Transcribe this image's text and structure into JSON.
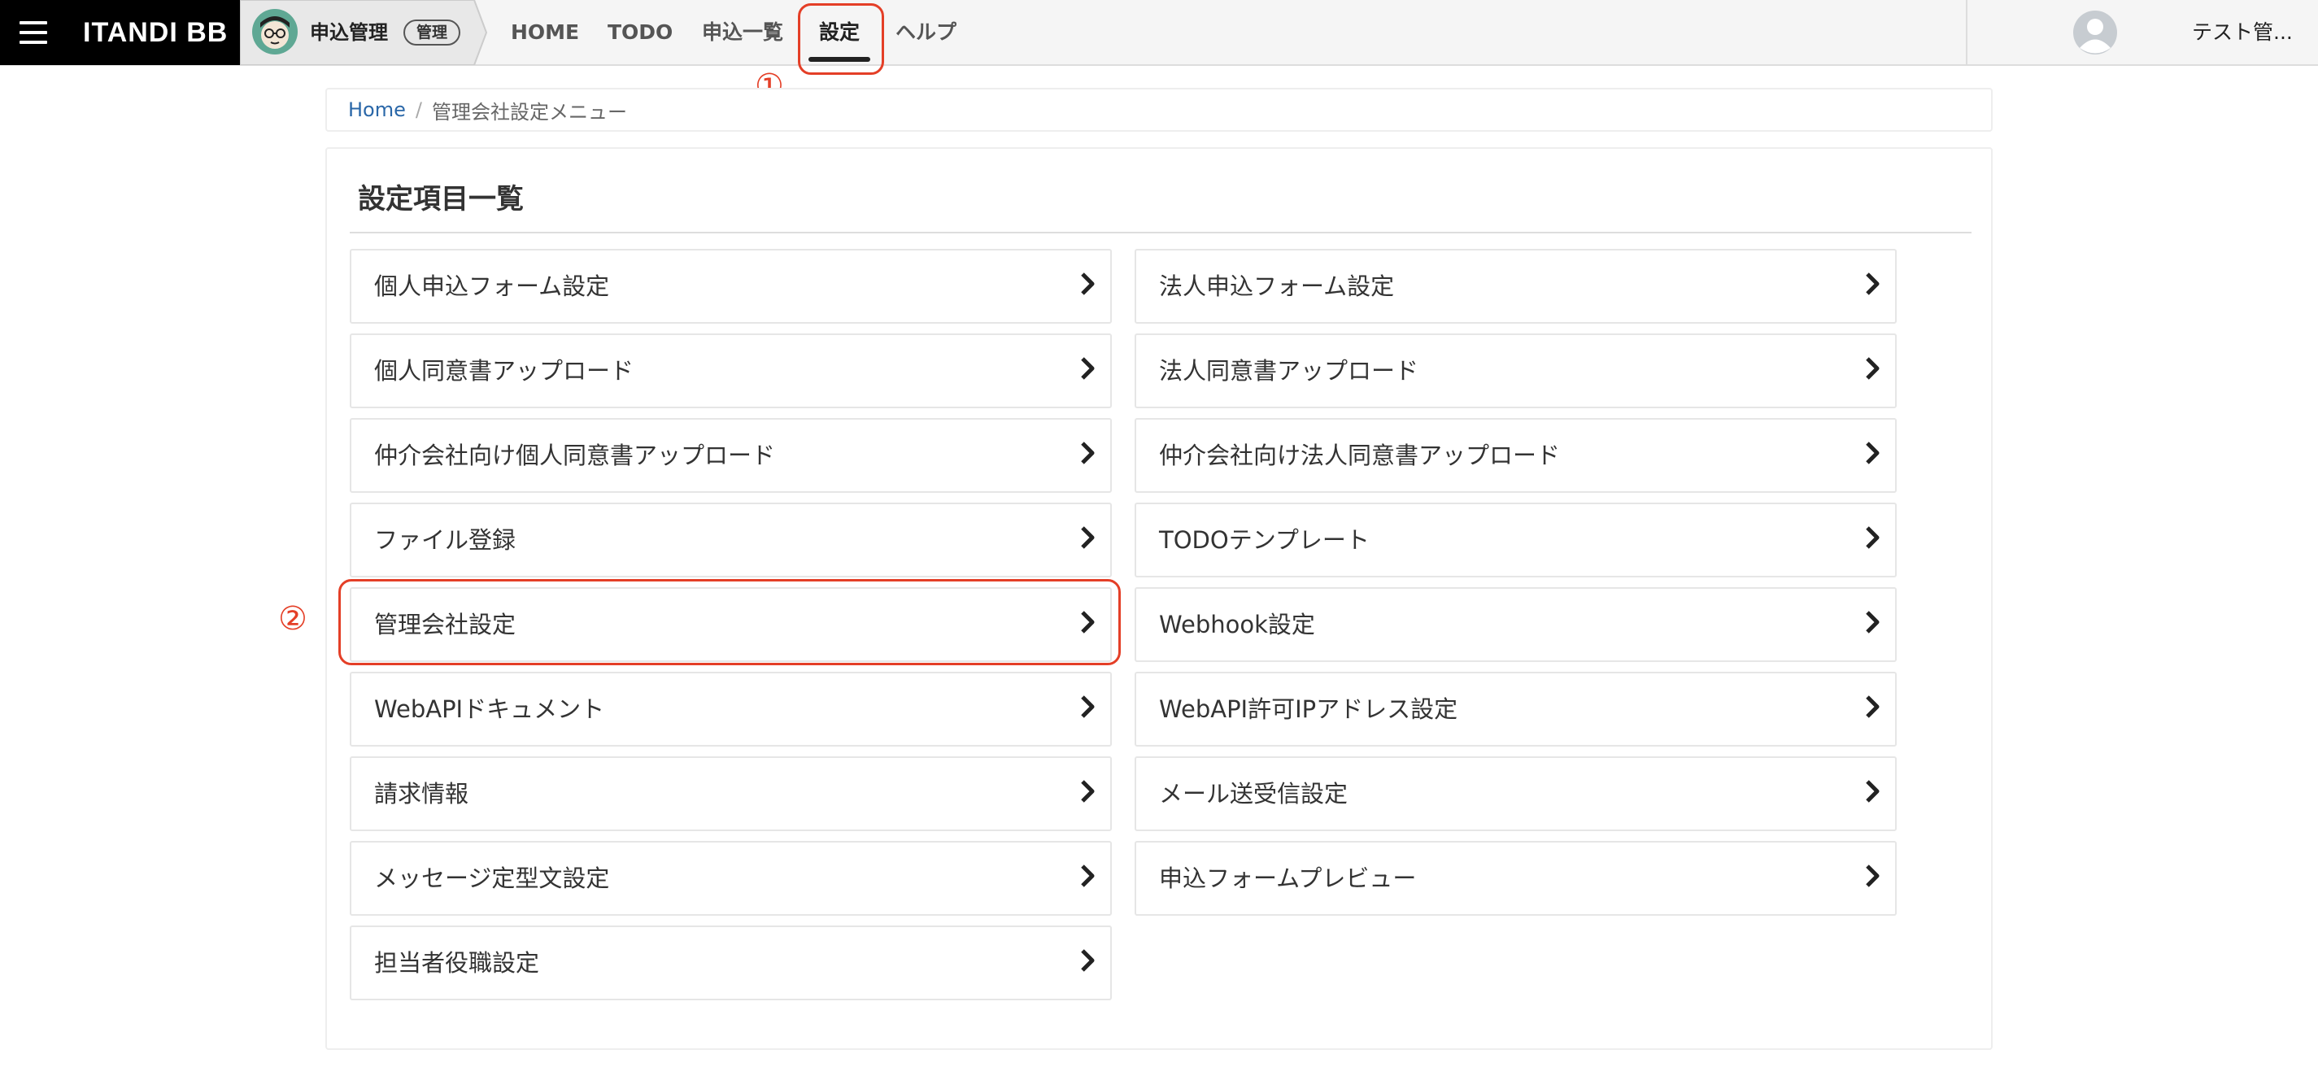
{
  "header": {
    "logo": "ITANDI BB",
    "app_name": "申込管理",
    "app_badge": "管理",
    "nav": [
      {
        "label": "HOME"
      },
      {
        "label": "TODO"
      },
      {
        "label": "申込一覧"
      },
      {
        "label": "設定",
        "active": true
      },
      {
        "label": "ヘルプ"
      }
    ],
    "user_name": "テスト管..."
  },
  "annotations": {
    "one": "①",
    "two": "②",
    "color": "#e43f27"
  },
  "breadcrumb": {
    "home": "Home",
    "separator": "/",
    "current": "管理会社設定メニュー"
  },
  "panel": {
    "title": "設定項目一覧",
    "left_items": [
      {
        "label": "個人申込フォーム設定"
      },
      {
        "label": "個人同意書アップロード"
      },
      {
        "label": "仲介会社向け個人同意書アップロード"
      },
      {
        "label": "ファイル登録"
      },
      {
        "label": "管理会社設定"
      },
      {
        "label": "WebAPIドキュメント"
      },
      {
        "label": "請求情報"
      },
      {
        "label": "メッセージ定型文設定"
      },
      {
        "label": "担当者役職設定"
      }
    ],
    "right_items": [
      {
        "label": "法人申込フォーム設定"
      },
      {
        "label": "法人同意書アップロード"
      },
      {
        "label": "仲介会社向け法人同意書アップロード"
      },
      {
        "label": "TODOテンプレート"
      },
      {
        "label": "Webhook設定"
      },
      {
        "label": "WebAPI許可IPアドレス設定"
      },
      {
        "label": "メール送受信設定"
      },
      {
        "label": "申込フォームプレビュー"
      }
    ]
  }
}
